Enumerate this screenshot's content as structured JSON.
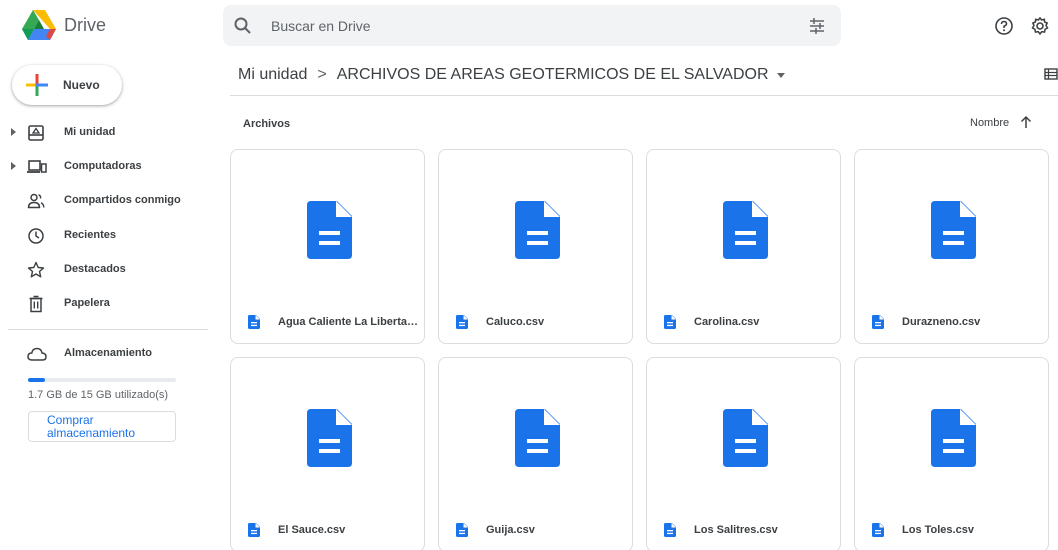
{
  "app": {
    "name": "Drive"
  },
  "search": {
    "placeholder": "Buscar en Drive"
  },
  "sidebar": {
    "new_label": "Nuevo",
    "items": [
      {
        "label": "Mi unidad",
        "icon": "my-drive-icon"
      },
      {
        "label": "Computadoras",
        "icon": "computer-icon"
      },
      {
        "label": "Compartidos conmigo",
        "icon": "shared-icon"
      },
      {
        "label": "Recientes",
        "icon": "clock-icon"
      },
      {
        "label": "Destacados",
        "icon": "star-icon"
      },
      {
        "label": "Papelera",
        "icon": "trash-icon"
      }
    ],
    "storage": {
      "label": "Almacenamiento",
      "usage_text": "1.7 GB de 15 GB utilizado(s)",
      "used_fraction": 0.113,
      "buy_label": "Comprar almacenamiento"
    }
  },
  "breadcrumb": {
    "root": "Mi unidad",
    "separator": ">",
    "current": "ARCHIVOS DE AREAS GEOTERMICOS DE EL SALVADOR"
  },
  "section": {
    "label": "Archivos"
  },
  "sort": {
    "label": "Nombre",
    "direction": "ascending"
  },
  "files": [
    {
      "name": "Agua Caliente La Libertad..."
    },
    {
      "name": "Caluco.csv"
    },
    {
      "name": "Carolina.csv"
    },
    {
      "name": "Durazneno.csv"
    },
    {
      "name": "El Sauce.csv"
    },
    {
      "name": "Guija.csv"
    },
    {
      "name": "Los Salitres.csv"
    },
    {
      "name": "Los Toles.csv"
    }
  ],
  "colors": {
    "accent": "#1a73e8",
    "doc_blue": "#1a73e8",
    "text": "#3c4043",
    "muted": "#5f6368",
    "border": "#dadce0"
  }
}
